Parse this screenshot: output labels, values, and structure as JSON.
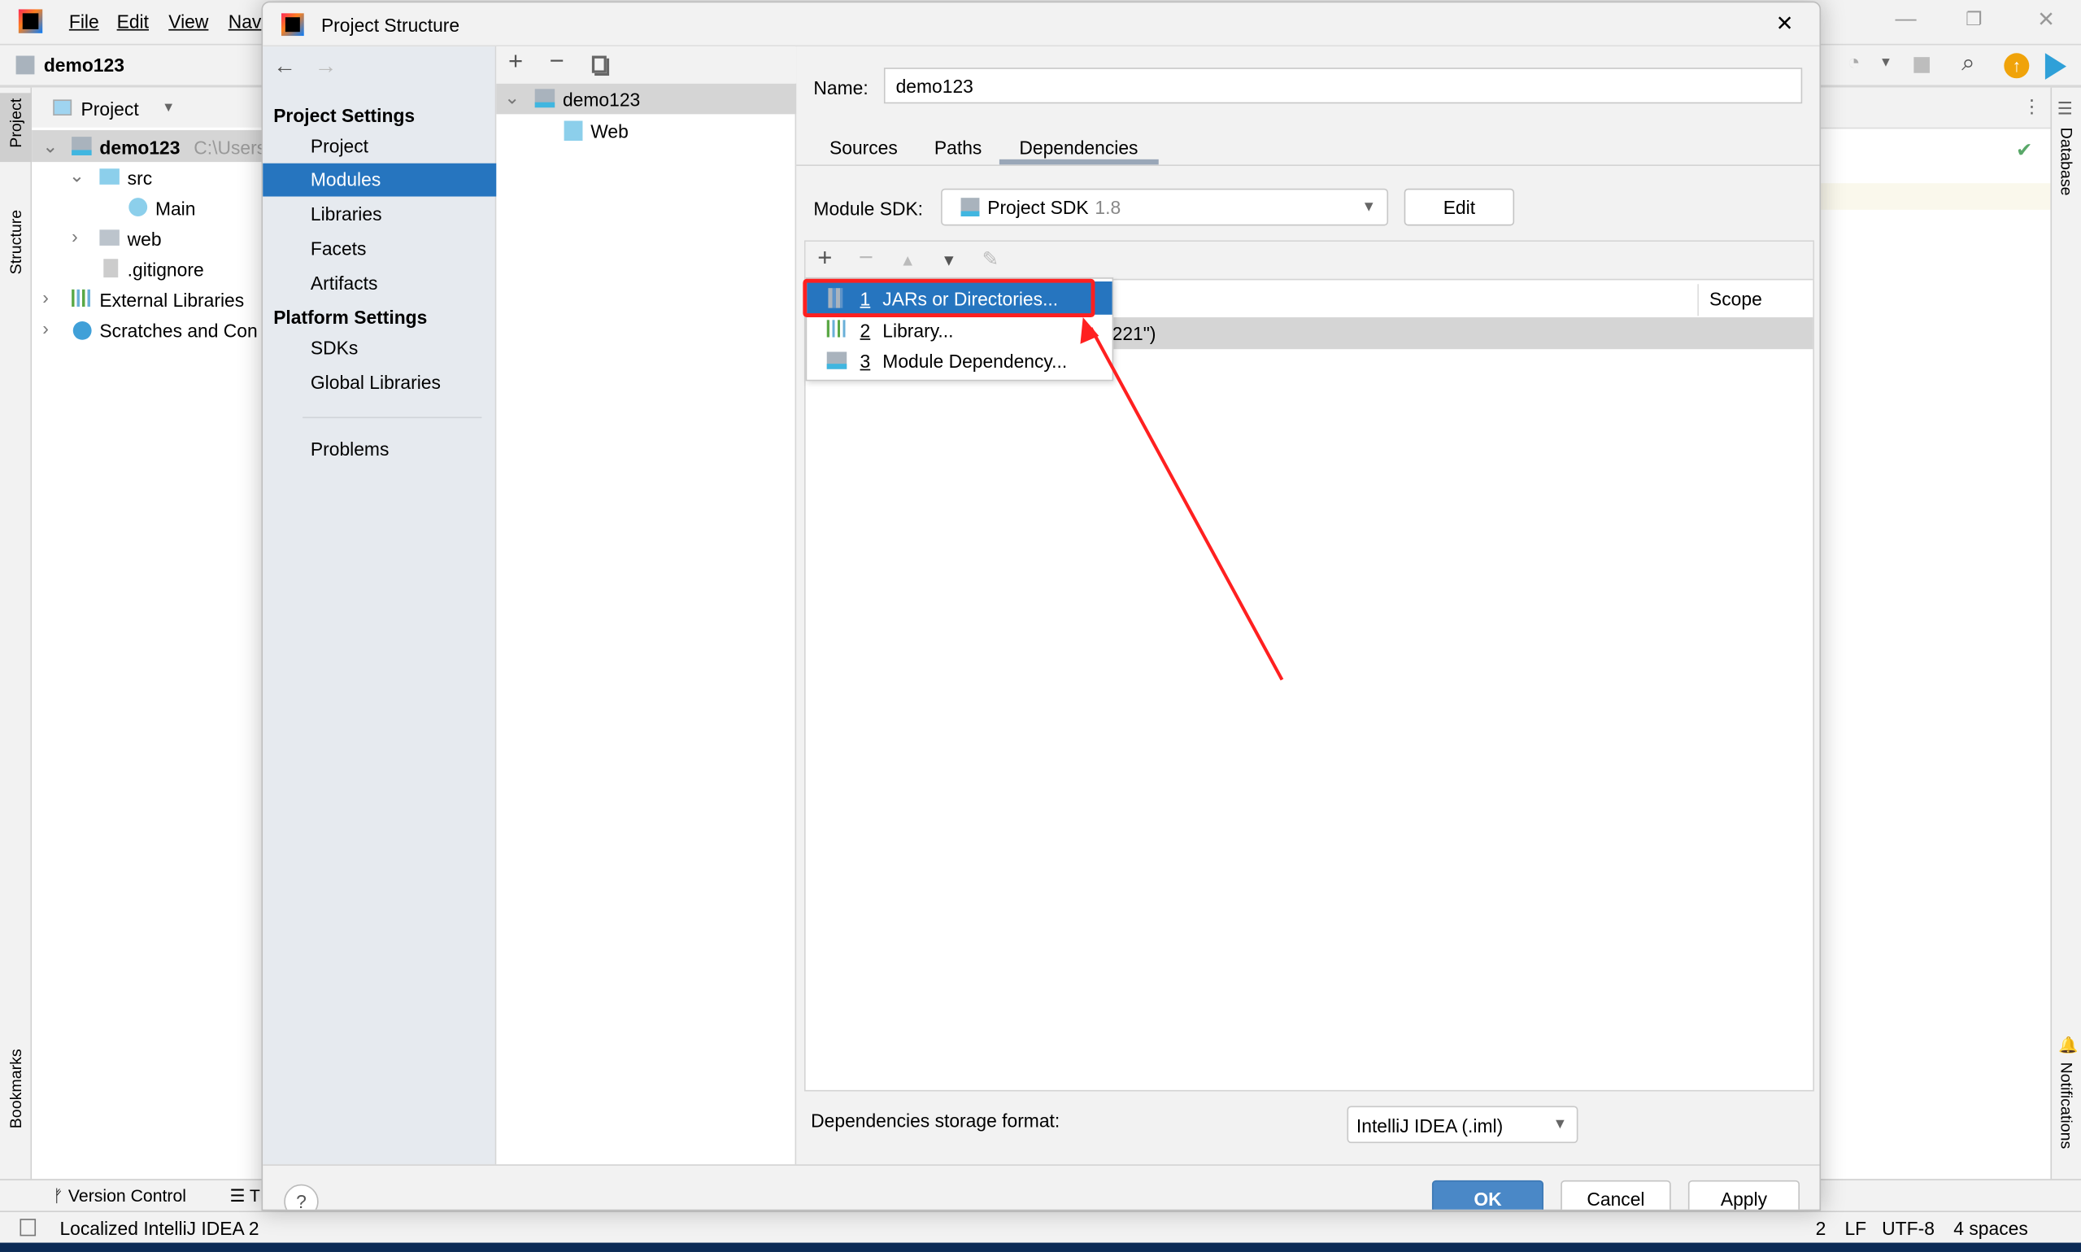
{
  "ide": {
    "menu": [
      "File",
      "Edit",
      "View",
      "Nav"
    ],
    "project_name": "demo123",
    "project_panel": {
      "title": "Project"
    },
    "tree": [
      {
        "label": "demo123",
        "hint": "C:\\Users"
      },
      {
        "label": "src"
      },
      {
        "label": "Main"
      },
      {
        "label": "web"
      },
      {
        "label": ".gitignore"
      },
      {
        "label": "External Libraries"
      },
      {
        "label": "Scratches and Con"
      }
    ],
    "left_tabs": [
      "Project",
      "Structure",
      "Bookmarks"
    ],
    "right_tabs": [
      "Database",
      "Notifications"
    ],
    "bottom_tabs": [
      "Version Control",
      "T"
    ],
    "status_message": "Localized IntelliJ IDEA 2",
    "status_right": [
      "2",
      "LF",
      "UTF-8",
      "4 spaces"
    ]
  },
  "dialog": {
    "title": "Project Structure",
    "nav": {
      "project_settings_header": "Project Settings",
      "project_settings": [
        "Project",
        "Modules",
        "Libraries",
        "Facets",
        "Artifacts"
      ],
      "platform_settings_header": "Platform Settings",
      "platform_settings": [
        "SDKs",
        "Global Libraries"
      ],
      "problems": "Problems",
      "selected": "Modules"
    },
    "modules_tree": [
      "demo123",
      "Web"
    ],
    "name_label": "Name:",
    "name_value": "demo123",
    "tabs": [
      "Sources",
      "Paths",
      "Dependencies"
    ],
    "active_tab": "Dependencies",
    "module_sdk_label": "Module SDK:",
    "module_sdk_value": "Project SDK",
    "module_sdk_version": "1.8",
    "edit_button": "Edit",
    "table": {
      "scope_header": "Scope",
      "row_text": "221\")"
    },
    "add_popup": [
      {
        "num": "1",
        "label": "JARs or Directories...",
        "selected": true
      },
      {
        "num": "2",
        "label": "Library..."
      },
      {
        "num": "3",
        "label": "Module Dependency..."
      }
    ],
    "storage_label": "Dependencies storage format:",
    "storage_value": "IntelliJ IDEA (.iml)",
    "ok": "OK",
    "cancel": "Cancel",
    "apply": "Apply",
    "help": "?"
  },
  "colors": {
    "selection": "#2675bf",
    "ok_button": "#4a88c7",
    "annotation": "#ff2020",
    "nav_bg": "#e6eaef"
  }
}
